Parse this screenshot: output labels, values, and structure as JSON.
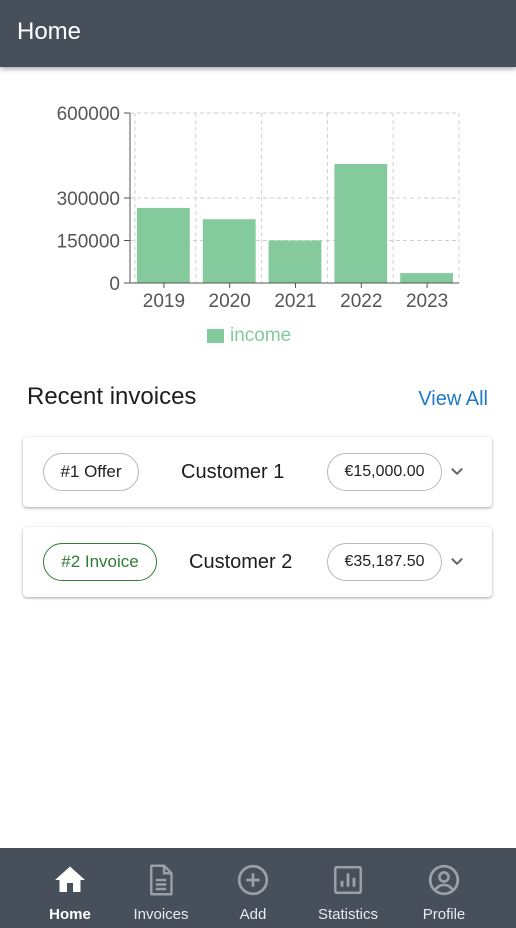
{
  "appbar": {
    "title": "Home"
  },
  "chart_data": {
    "type": "bar",
    "categories": [
      "2019",
      "2020",
      "2021",
      "2022",
      "2023"
    ],
    "series": [
      {
        "name": "income",
        "values": [
          265000,
          225000,
          150000,
          420000,
          35000
        ]
      }
    ],
    "yticks": [
      "0",
      "150000",
      "300000",
      "600000"
    ],
    "ylim": [
      0,
      600000
    ],
    "grid": true,
    "legend": "bottom",
    "bar_color": "#84ca9c"
  },
  "recent": {
    "title": "Recent invoices",
    "view_all": "View All",
    "items": [
      {
        "tag": "#1 Offer",
        "customer": "Customer 1",
        "amount": "€15,000.00",
        "kind": "offer"
      },
      {
        "tag": "#2 Invoice",
        "customer": "Customer 2",
        "amount": "€35,187.50",
        "kind": "invoice"
      }
    ]
  },
  "nav": {
    "items": [
      {
        "label": "Home",
        "icon": "home-icon",
        "active": true
      },
      {
        "label": "Invoices",
        "icon": "document-icon",
        "active": false
      },
      {
        "label": "Add",
        "icon": "add-circle-icon",
        "active": false
      },
      {
        "label": "Statistics",
        "icon": "bar-chart-icon",
        "active": false
      },
      {
        "label": "Profile",
        "icon": "account-circle-icon",
        "active": false
      }
    ]
  },
  "colors": {
    "appbar": "#474f5a",
    "accent": "#1f78c8",
    "invoice_chip": "#2e7d32"
  }
}
